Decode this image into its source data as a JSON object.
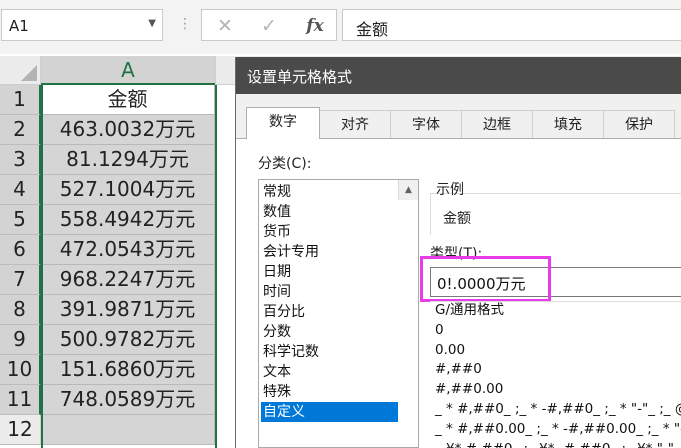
{
  "formula_bar": {
    "name_box": "A1",
    "cancel_icon": "✕",
    "enter_icon": "✓",
    "fx_label": "fx",
    "content": "金额"
  },
  "sheet": {
    "column_a": "A",
    "rows": [
      {
        "num": "1",
        "value": "金额"
      },
      {
        "num": "2",
        "value": "463.0032万元"
      },
      {
        "num": "3",
        "value": "81.1294万元"
      },
      {
        "num": "4",
        "value": "527.1004万元"
      },
      {
        "num": "5",
        "value": "558.4942万元"
      },
      {
        "num": "6",
        "value": "472.0543万元"
      },
      {
        "num": "7",
        "value": "968.2247万元"
      },
      {
        "num": "8",
        "value": "391.9871万元"
      },
      {
        "num": "9",
        "value": "500.9782万元"
      },
      {
        "num": "10",
        "value": "151.6860万元"
      },
      {
        "num": "11",
        "value": "748.0589万元"
      },
      {
        "num": "12",
        "value": ""
      }
    ]
  },
  "dialog": {
    "title": "设置单元格格式",
    "tabs": [
      "数字",
      "对齐",
      "字体",
      "边框",
      "填充",
      "保护"
    ],
    "active_tab": "数字",
    "category_label": "分类(C):",
    "categories": [
      "常规",
      "数值",
      "货币",
      "会计专用",
      "日期",
      "时间",
      "百分比",
      "分数",
      "科学记数",
      "文本",
      "特殊",
      "自定义"
    ],
    "selected_category": "自定义",
    "example_label": "示例",
    "example_value": "金额",
    "type_label": "类型(T):",
    "type_value": "0!.0000万元",
    "formats": [
      "G/通用格式",
      "0",
      "0.00",
      "#,##0",
      "#,##0.00",
      "_ * #,##0_ ;_ * -#,##0_ ;_ * \"-\"_ ;_ @",
      "_ * #,##0.00_ ;_ * -#,##0.00_ ;_ * \"-",
      "_ ¥* #,##0_ ;_ ¥* -#,##0_ ;_ ¥* \"-\"_ ;"
    ],
    "highlight_color": "#e83ce8",
    "accent_color": "#217346",
    "selection_color": "#0078d7"
  }
}
